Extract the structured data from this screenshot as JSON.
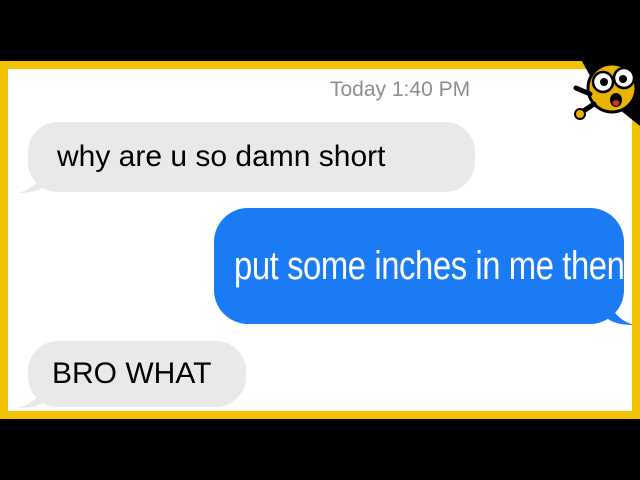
{
  "conversation": {
    "timestamp": "Today 1:40 PM",
    "messages": [
      {
        "direction": "incoming",
        "text": "why are u so damn short"
      },
      {
        "direction": "outgoing",
        "text": "put some inches in me then"
      },
      {
        "direction": "incoming",
        "text": "BRO WHAT"
      }
    ]
  },
  "colors": {
    "frame": "#f2c200",
    "incoming_bubble": "#e9e9eb",
    "outgoing_bubble": "#1a7bf5",
    "timestamp": "#8e8e93"
  },
  "mascot_icon": "cartoon-face-icon"
}
